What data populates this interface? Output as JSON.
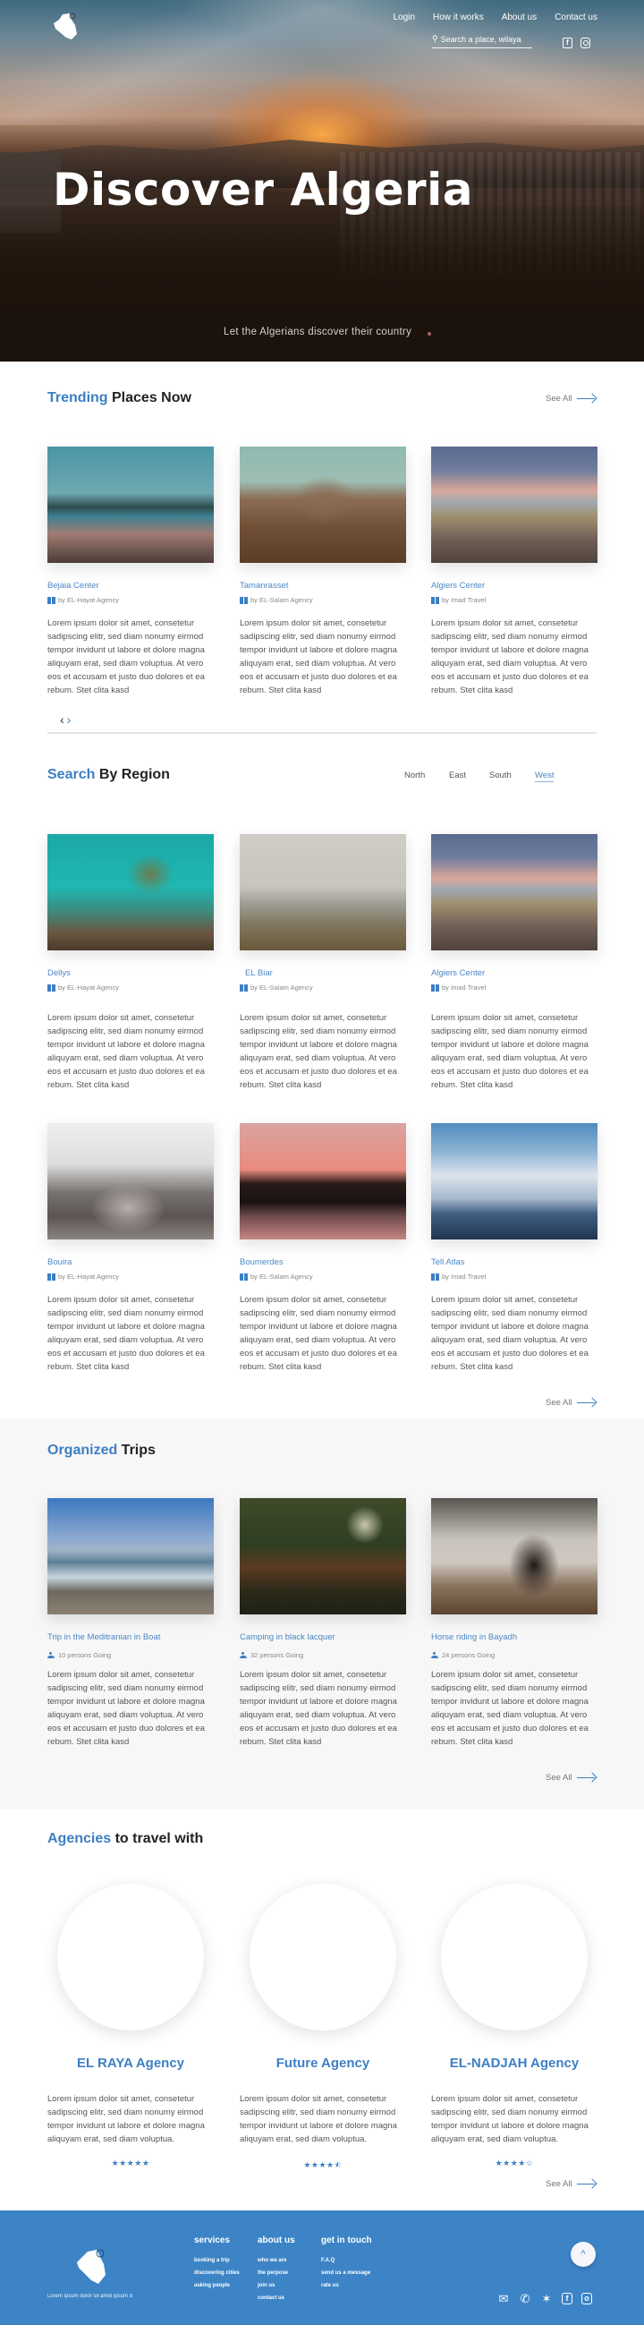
{
  "header": {
    "nav": [
      "Login",
      "How it works",
      "About us",
      "Contact us"
    ],
    "search_placeholder": "Search a place, wilaya",
    "social": [
      "facebook-icon",
      "instagram-icon"
    ]
  },
  "hero": {
    "title": "Discover Algeria",
    "subtitle": "Let the Algerians discover their country"
  },
  "trending": {
    "title_accent": "Trending",
    "title_rest": " Places Now",
    "see_all": "See All",
    "cards": [
      {
        "name": "Bejaia Center",
        "agency": "by EL-Hayat Agency",
        "desc": "Lorem ipsum dolor sit amet, consetetur sadipscing elitr, sed diam nonumy eirmod tempor invidunt ut labore et dolore magna aliquyam erat, sed diam voluptua. At vero eos et accusam et justo duo dolores et ea rebum. Stet clita kasd"
      },
      {
        "name": "Tamanrasset",
        "agency": "by EL-Salam Agency",
        "desc": "Lorem ipsum dolor sit amet, consetetur sadipscing elitr, sed diam nonumy eirmod tempor invidunt ut labore et dolore magna aliquyam erat, sed diam voluptua. At vero eos et accusam et justo duo dolores et ea rebum. Stet clita kasd"
      },
      {
        "name": "Algiers Center",
        "agency": "by Imad Travel",
        "desc": "Lorem ipsum dolor sit amet, consetetur sadipscing elitr, sed diam nonumy eirmod tempor invidunt ut labore et dolore magna aliquyam erat, sed diam voluptua. At vero eos et accusam et justo duo dolores et ea rebum. Stet clita kasd"
      }
    ],
    "prev": "‹",
    "next": "›"
  },
  "region": {
    "title_accent": "Search",
    "title_rest": " By Region",
    "tabs": [
      "North",
      "East",
      "South",
      "West"
    ],
    "active_tab": "West",
    "see_all": "See All",
    "cards": [
      {
        "name": "Dellys",
        "agency": "by EL-Hayat Agency",
        "desc": "Lorem ipsum dolor sit amet, consetetur sadipscing elitr, sed diam nonumy eirmod tempor invidunt ut labore et dolore magna aliquyam erat, sed diam voluptua. At vero eos et accusam et justo duo dolores et ea rebum. Stet clita kasd"
      },
      {
        "name": "EL Biar",
        "agency": "by EL-Salam Agency",
        "desc": "Lorem ipsum dolor sit amet, consetetur sadipscing elitr, sed diam nonumy eirmod tempor invidunt ut labore et dolore magna aliquyam erat, sed diam voluptua. At vero eos et accusam et justo duo dolores et ea rebum. Stet clita kasd"
      },
      {
        "name": "Algiers Center",
        "agency": "by Imad Travel",
        "desc": "Lorem ipsum dolor sit amet, consetetur sadipscing elitr, sed diam nonumy eirmod tempor invidunt ut labore et dolore magna aliquyam erat, sed diam voluptua. At vero eos et accusam et justo duo dolores et ea rebum. Stet clita kasd"
      },
      {
        "name": "Bouira",
        "agency": "by EL-Hayat Agency",
        "desc": "Lorem ipsum dolor sit amet, consetetur sadipscing elitr, sed diam nonumy eirmod tempor invidunt ut labore et dolore magna aliquyam erat, sed diam voluptua. At vero eos et accusam et justo duo dolores et ea rebum. Stet clita kasd"
      },
      {
        "name": "Boumerdes",
        "agency": "by EL-Salam Agency",
        "desc": "Lorem ipsum dolor sit amet, consetetur sadipscing elitr, sed diam nonumy eirmod tempor invidunt ut labore et dolore magna aliquyam erat, sed diam voluptua. At vero eos et accusam et justo duo dolores et ea rebum. Stet clita kasd"
      },
      {
        "name": "Tell Atlas",
        "agency": "by Imad Travel",
        "desc": "Lorem ipsum dolor sit amet, consetetur sadipscing elitr, sed diam nonumy eirmod tempor invidunt ut labore et dolore magna aliquyam erat, sed diam voluptua. At vero eos et accusam et justo duo dolores et ea rebum. Stet clita kasd"
      }
    ]
  },
  "trips": {
    "title_accent": "Organized",
    "title_rest": " Trips",
    "see_all": "See All",
    "cards": [
      {
        "name": "Trip in the Meditranian in Boat",
        "going": "10 persons Going",
        "desc": "Lorem ipsum dolor sit amet, consetetur sadipscing elitr, sed diam nonumy eirmod tempor invidunt ut labore et dolore magna aliquyam erat, sed diam voluptua. At vero eos et accusam et justo duo dolores et ea rebum. Stet clita kasd"
      },
      {
        "name": "Camping in black lacquer",
        "going": "32 persons Going",
        "desc": "Lorem ipsum dolor sit amet, consetetur sadipscing elitr, sed diam nonumy eirmod tempor invidunt ut labore et dolore magna aliquyam erat, sed diam voluptua. At vero eos et accusam et justo duo dolores et ea rebum. Stet clita kasd"
      },
      {
        "name": "Horse riding in Bayadh",
        "going": "24 persons Going",
        "desc": "Lorem ipsum dolor sit amet, consetetur sadipscing elitr, sed diam nonumy eirmod tempor invidunt ut labore et dolore magna aliquyam erat, sed diam voluptua. At vero eos et accusam et justo duo dolores et ea rebum. Stet clita kasd"
      }
    ]
  },
  "agencies": {
    "title_accent": "Agencies",
    "title_rest": " to travel with",
    "see_all": "See All",
    "items": [
      {
        "name": "EL RAYA Agency",
        "desc": "Lorem ipsum dolor sit amet, consetetur sadipscing elitr, sed diam nonumy eirmod tempor invidunt ut labore et dolore magna aliquyam erat, sed diam voluptua.",
        "rating": 5,
        "stars": "★★★★★"
      },
      {
        "name": "Future Agency",
        "desc": "Lorem ipsum dolor sit amet, consetetur sadipscing elitr, sed diam nonumy eirmod tempor invidunt ut labore et dolore magna aliquyam erat, sed diam voluptua.",
        "rating": 4.5,
        "stars": "★★★★⯪"
      },
      {
        "name": "EL-NADJAH Agency",
        "desc": "Lorem ipsum dolor sit amet, consetetur sadipscing elitr, sed diam nonumy eirmod tempor invidunt ut labore et dolore magna aliquyam erat, sed diam voluptua.",
        "rating": 4,
        "stars": "★★★★☆"
      }
    ]
  },
  "footer": {
    "tagline": "Lorem ipsum dolor sit amet ipsum d",
    "columns": [
      {
        "heading": "services",
        "links": [
          "booking a trip",
          "discovering cities",
          "asking people"
        ]
      },
      {
        "heading": "about us",
        "links": [
          "who we are",
          "the perpose",
          "join us",
          "contact us"
        ]
      },
      {
        "heading": "get in touch",
        "links": [
          "F.A.Q",
          "send us a message",
          "rate us"
        ]
      }
    ],
    "to_top": "^",
    "social": [
      "mail-icon",
      "phone-icon",
      "twitter-icon",
      "facebook-icon",
      "instagram-icon"
    ]
  },
  "colors": {
    "accent": "#3d7fc4",
    "footer_bg": "#3c84c6",
    "gray_section": "#f7f7f7"
  }
}
